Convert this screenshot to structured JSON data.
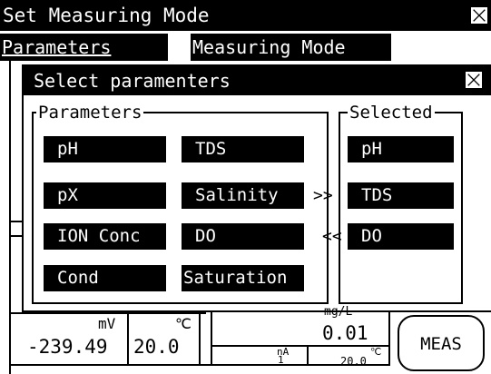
{
  "window": {
    "title": "Set Measuring Mode",
    "tabs": [
      "Parameters",
      "Measuring Mode"
    ]
  },
  "dialog": {
    "title": "Select paramenters",
    "parameters_group": {
      "label": "Parameters",
      "items": [
        "pH",
        "TDS",
        "pX",
        "Salinity",
        "ION Conc",
        "DO",
        "Cond",
        "Saturation"
      ]
    },
    "selected_group": {
      "label": "Selected",
      "items": [
        "pH",
        "TDS",
        "DO"
      ]
    },
    "add_arrow": ">>",
    "remove_arrow": "<<"
  },
  "readings": {
    "mv_label": "mV",
    "mv_value": "-239.49",
    "temp_label": "℃",
    "temp_value": "20.0",
    "conc_label": "mg/L",
    "conc_value": "0.01",
    "na_label": "nA",
    "na_value": "1",
    "temp2_label": "℃",
    "temp2_value": "20.0",
    "meas_button": "MEAS"
  },
  "icons": {
    "close": "close-icon"
  }
}
